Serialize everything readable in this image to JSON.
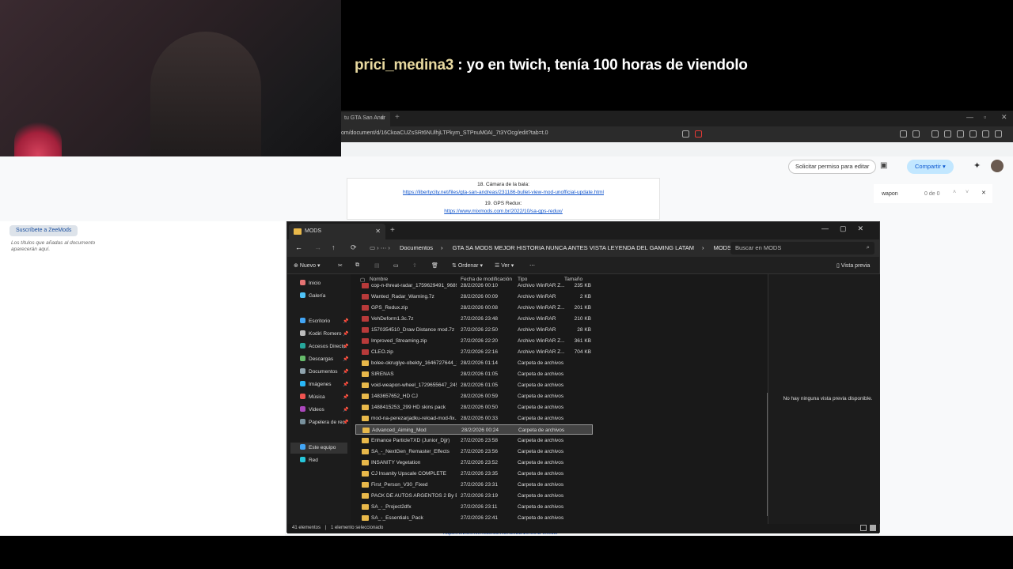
{
  "chat": {
    "user": "prici_medina3",
    "message": ": yo en twich, tenía 100 horas de viendolo"
  },
  "browser": {
    "tab_label": "tu GTA San Andr",
    "url": "om/document/d/16CkoaCUZsSRt6NUlhjLTPkym_STPnuM0AI_7t3YOcg/edit?tab=t.0",
    "request_edit": "Solicitar permiso para editar",
    "share": "Compartir",
    "find_query": "wapon",
    "find_count": "0 de 0"
  },
  "doc": {
    "item18": "18. Cámara de la bala:",
    "link18": "https://libertycity.net/files/gta-san-andreas/231186-bullet-view-mod-unofficial-update.html",
    "item19": "19. GPS Redux:",
    "link19": "https://www.mixmods.com.br/2022/10/sa-gps-redux/",
    "subscribe": "Suscríbete a ZeeMods",
    "sidebar_hint": "Los títulos que añadas al documento aparecerán aquí.",
    "bottom_link": "https://www.mixmods.com.br/2022/10/wind-effects"
  },
  "explorer": {
    "tab_title": "MODS",
    "breadcrumb": [
      "Documentos",
      "GTA SA MODS MEJOR HISTORIA NUNCA ANTES VISTA LEYENDA DEL GAMING LATAM",
      "MODS"
    ],
    "search_placeholder": "Buscar en MODS",
    "cmd": {
      "new": "Nuevo",
      "sort": "Ordenar",
      "view": "Ver",
      "preview": "Vista previa"
    },
    "columns": {
      "name": "Nombre",
      "date": "Fecha de modificación",
      "type": "Tipo",
      "size": "Tamaño"
    },
    "nav": [
      {
        "label": "Inicio",
        "color": "#e57373"
      },
      {
        "label": "Galería",
        "color": "#4fc3f7"
      },
      {
        "label": "Escritorio",
        "color": "#42a5f5"
      },
      {
        "label": "Kodiri Romero",
        "color": "#bdbdbd"
      },
      {
        "label": "Accesos Directo",
        "color": "#26a69a"
      },
      {
        "label": "Descargas",
        "color": "#66bb6a"
      },
      {
        "label": "Documentos",
        "color": "#90a4ae"
      },
      {
        "label": "Imágenes",
        "color": "#29b6f6"
      },
      {
        "label": "Música",
        "color": "#ef5350"
      },
      {
        "label": "Videos",
        "color": "#ab47bc"
      },
      {
        "label": "Papelera de reci",
        "color": "#78909c"
      },
      {
        "label": "Este equipo",
        "color": "#42a5f5"
      },
      {
        "label": "Red",
        "color": "#26c6da"
      }
    ],
    "files": [
      {
        "name": "cop-n-threat-radar_1759629491_96891...",
        "date": "28/2/2026 00:10",
        "type": "Archivo WinRAR Z...",
        "size": "235 KB",
        "kind": "zip"
      },
      {
        "name": "Wanted_Radar_Warning.7z",
        "date": "28/2/2026 00:09",
        "type": "Archivo WinRAR",
        "size": "2 KB",
        "kind": "zip"
      },
      {
        "name": "GPS_Redux.zip",
        "date": "28/2/2026 00:08",
        "type": "Archivo WinRAR Z...",
        "size": "201 KB",
        "kind": "zip"
      },
      {
        "name": "VehDeform1.3c.7z",
        "date": "27/2/2026 23:48",
        "type": "Archivo WinRAR",
        "size": "210 KB",
        "kind": "zip"
      },
      {
        "name": "1570354510_Draw Distance mod.7z",
        "date": "27/2/2026 22:50",
        "type": "Archivo WinRAR",
        "size": "28 KB",
        "kind": "zip"
      },
      {
        "name": "Improved_Streaming.zip",
        "date": "27/2/2026 22:20",
        "type": "Archivo WinRAR Z...",
        "size": "361 KB",
        "kind": "zip"
      },
      {
        "name": "CLEO.zip",
        "date": "27/2/2026 22:16",
        "type": "Archivo WinRAR Z...",
        "size": "704 KB",
        "kind": "zip"
      },
      {
        "name": "bolee-okruglye-obekty_1646727644_2...",
        "date": "28/2/2026 01:14",
        "type": "Carpeta de archivos",
        "size": "",
        "kind": "folder"
      },
      {
        "name": "SIRENAS",
        "date": "28/2/2026 01:05",
        "type": "Carpeta de archivos",
        "size": "",
        "kind": "folder"
      },
      {
        "name": "void-weapon-wheel_1729655647_2452...",
        "date": "28/2/2026 01:05",
        "type": "Carpeta de archivos",
        "size": "",
        "kind": "folder"
      },
      {
        "name": "1483657652_HD CJ",
        "date": "28/2/2026 00:59",
        "type": "Carpeta de archivos",
        "size": "",
        "kind": "folder"
      },
      {
        "name": "1488415253_299 HD skins pack",
        "date": "28/2/2026 00:50",
        "type": "Carpeta de archivos",
        "size": "",
        "kind": "folder"
      },
      {
        "name": "mod-na-perezarjadku-reload-mod-fix...",
        "date": "28/2/2026 00:33",
        "type": "Carpeta de archivos",
        "size": "",
        "kind": "folder"
      },
      {
        "name": "Advanced_Aiming_Mod",
        "date": "28/2/2026 00:24",
        "type": "Carpeta de archivos",
        "size": "",
        "kind": "folder",
        "selected": true
      },
      {
        "name": "Enhance ParticleTXD (Junior_Djjr)",
        "date": "27/2/2026 23:58",
        "type": "Carpeta de archivos",
        "size": "",
        "kind": "folder"
      },
      {
        "name": "SA_-_NextGen_Remaster_Effects",
        "date": "27/2/2026 23:56",
        "type": "Carpeta de archivos",
        "size": "",
        "kind": "folder"
      },
      {
        "name": "INSANITY Vegetation",
        "date": "27/2/2026 23:52",
        "type": "Carpeta de archivos",
        "size": "",
        "kind": "folder"
      },
      {
        "name": "CJ Insanity Upscale COMPLETE",
        "date": "27/2/2026 23:35",
        "type": "Carpeta de archivos",
        "size": "",
        "kind": "folder"
      },
      {
        "name": "First_Person_V30_Fixed",
        "date": "27/2/2026 23:31",
        "type": "Carpeta de archivos",
        "size": "",
        "kind": "folder"
      },
      {
        "name": "PACK DE AUTOS ARGENTOS 2 By ELC...",
        "date": "27/2/2026 23:19",
        "type": "Carpeta de archivos",
        "size": "",
        "kind": "folder"
      },
      {
        "name": "SA_-_Project2dfx",
        "date": "27/2/2026 23:11",
        "type": "Carpeta de archivos",
        "size": "",
        "kind": "folder"
      },
      {
        "name": "SA_-_Essentials_Pack",
        "date": "27/2/2026 22:41",
        "type": "Carpeta de archivos",
        "size": "",
        "kind": "folder"
      }
    ],
    "preview_msg": "No hay ninguna vista previa disponible.",
    "status_count": "41 elementos",
    "status_sel": "1 elemento seleccionado"
  }
}
